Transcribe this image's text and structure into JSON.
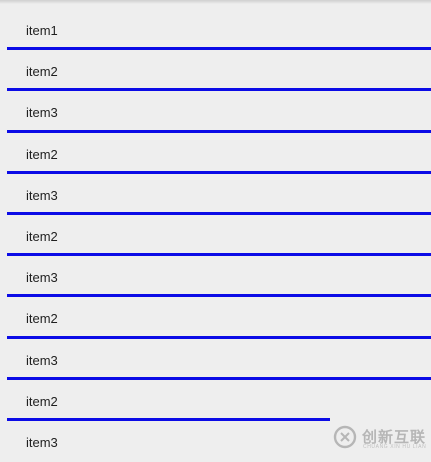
{
  "list": {
    "items": [
      {
        "label": "item1"
      },
      {
        "label": "item2"
      },
      {
        "label": "item3"
      },
      {
        "label": "item2"
      },
      {
        "label": "item3"
      },
      {
        "label": "item2"
      },
      {
        "label": "item3"
      },
      {
        "label": "item2"
      },
      {
        "label": "item3"
      },
      {
        "label": "item2"
      },
      {
        "label": "item3"
      }
    ],
    "divider_color": "#0b0be6",
    "background_color": "#eeeeee"
  },
  "watermark": {
    "text": "创新互联",
    "subtext": "CHUANG XIN HU LIAN",
    "icon": "brand-logo"
  }
}
